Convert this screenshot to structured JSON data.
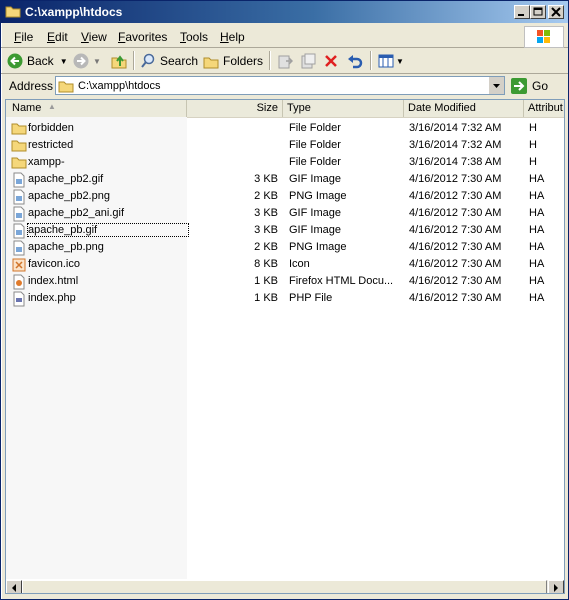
{
  "window": {
    "title": "C:\\xampp\\htdocs"
  },
  "menu": [
    "File",
    "Edit",
    "View",
    "Favorites",
    "Tools",
    "Help"
  ],
  "toolbar": {
    "back_label": "Back",
    "search_label": "Search",
    "folders_label": "Folders"
  },
  "address": {
    "label": "Address",
    "value": "C:\\xampp\\htdocs",
    "go_label": "Go"
  },
  "columns": {
    "name": "Name",
    "size": "Size",
    "type": "Type",
    "modified": "Date Modified",
    "attributes": "Attribut"
  },
  "files": [
    {
      "name": "forbidden",
      "size": "",
      "type": "File Folder",
      "modified": "3/16/2014 7:32 AM",
      "attr": "H",
      "icon": "folder-icon"
    },
    {
      "name": "restricted",
      "size": "",
      "type": "File Folder",
      "modified": "3/16/2014 7:32 AM",
      "attr": "H",
      "icon": "folder-icon"
    },
    {
      "name": "xampp-",
      "size": "",
      "type": "File Folder",
      "modified": "3/16/2014 7:38 AM",
      "attr": "H",
      "icon": "folder-icon"
    },
    {
      "name": "apache_pb2.gif",
      "size": "3 KB",
      "type": "GIF Image",
      "modified": "4/16/2012 7:30 AM",
      "attr": "HA",
      "icon": "image-file-icon"
    },
    {
      "name": "apache_pb2.png",
      "size": "2 KB",
      "type": "PNG Image",
      "modified": "4/16/2012 7:30 AM",
      "attr": "HA",
      "icon": "image-file-icon"
    },
    {
      "name": "apache_pb2_ani.gif",
      "size": "3 KB",
      "type": "GIF Image",
      "modified": "4/16/2012 7:30 AM",
      "attr": "HA",
      "icon": "image-file-icon"
    },
    {
      "name": "apache_pb.gif",
      "size": "3 KB",
      "type": "GIF Image",
      "modified": "4/16/2012 7:30 AM",
      "attr": "HA",
      "icon": "image-file-icon"
    },
    {
      "name": "apache_pb.png",
      "size": "2 KB",
      "type": "PNG Image",
      "modified": "4/16/2012 7:30 AM",
      "attr": "HA",
      "icon": "image-file-icon"
    },
    {
      "name": "favicon.ico",
      "size": "8 KB",
      "type": "Icon",
      "modified": "4/16/2012 7:30 AM",
      "attr": "HA",
      "icon": "ico-file-icon"
    },
    {
      "name": "index.html",
      "size": "1 KB",
      "type": "Firefox HTML Docu...",
      "modified": "4/16/2012 7:30 AM",
      "attr": "HA",
      "icon": "html-file-icon"
    },
    {
      "name": "index.php",
      "size": "1 KB",
      "type": "PHP File",
      "modified": "4/16/2012 7:30 AM",
      "attr": "HA",
      "icon": "php-file-icon"
    }
  ]
}
